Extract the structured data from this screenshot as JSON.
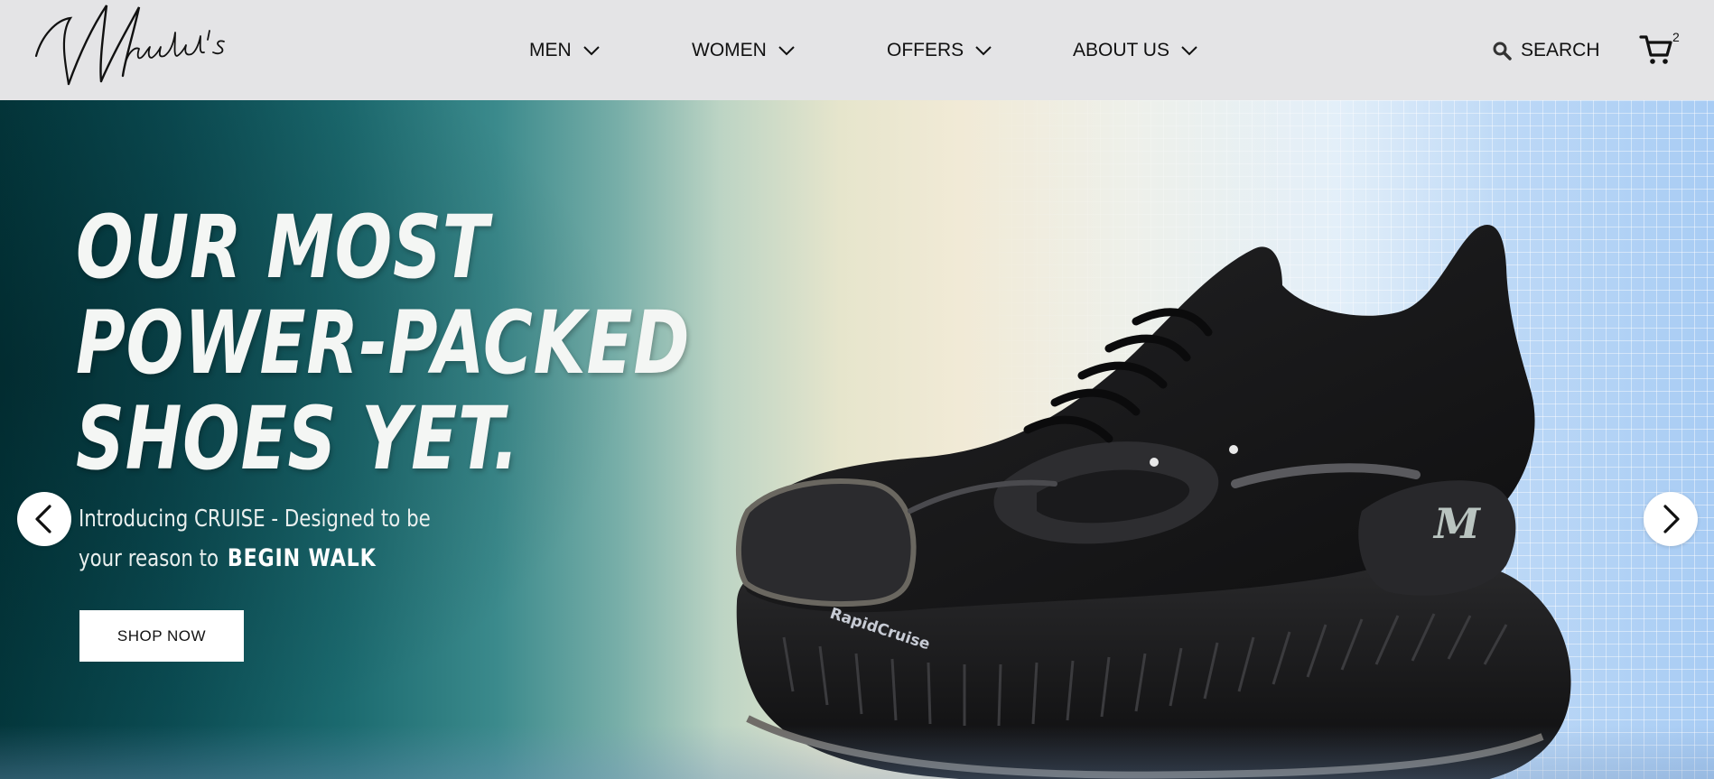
{
  "brand": {
    "logo_text": "Mridul's"
  },
  "nav": {
    "items": [
      {
        "label": "MEN"
      },
      {
        "label": "WOMEN"
      },
      {
        "label": "OFFERS"
      },
      {
        "label": "ABOUT US"
      }
    ],
    "search_label": "SEARCH",
    "cart_count": "2"
  },
  "hero": {
    "headline": [
      "OUR MOST",
      "POWER-PACKED",
      "SHOES YET."
    ],
    "intro_line1": "Introducing CRUISE - Designed to be",
    "intro_line2": "your reason to",
    "intro_brand": "BEGIN WALK",
    "cta_label": "SHOP NOW",
    "shoe_side_text": "RapidCruise",
    "shoe_logo_text": "M"
  },
  "colors": {
    "header_bg": "#e4e4e6",
    "hero_dark": "#03383d",
    "hero_light": "#a8ccf4",
    "text_light": "#f4f6f4"
  },
  "icons": {
    "nav_chevron": "chevron-down-icon",
    "search": "search-icon",
    "cart": "cart-icon",
    "prev": "chevron-left-icon",
    "next": "chevron-right-icon"
  }
}
